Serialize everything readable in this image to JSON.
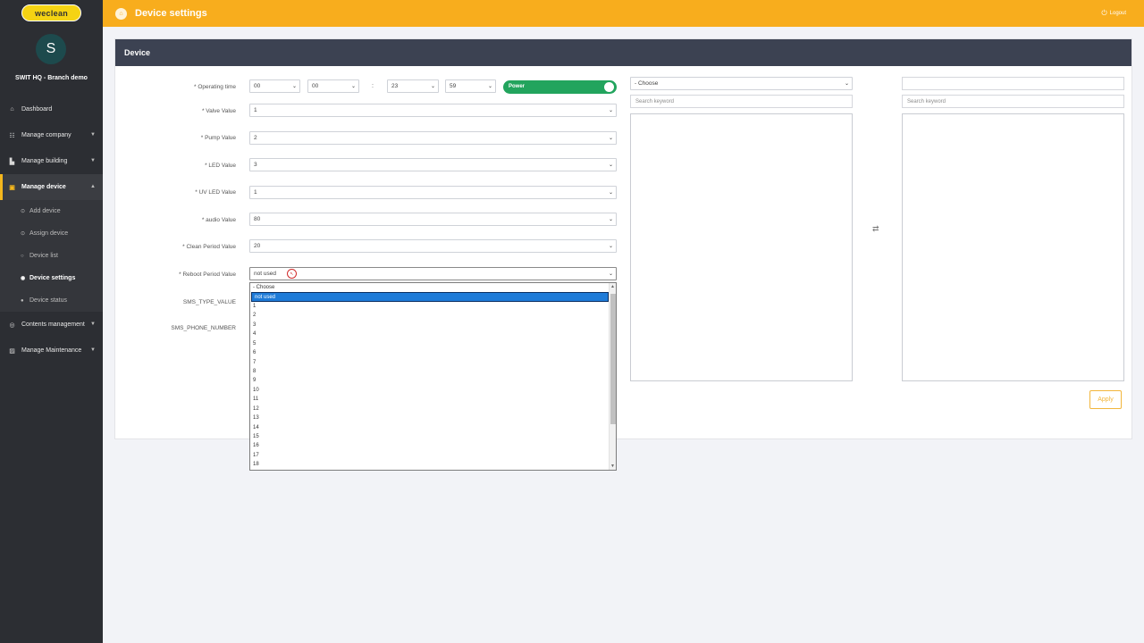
{
  "brand": {
    "logo_text": "weclean",
    "accent_color": "#f8ad1d"
  },
  "user": {
    "avatar_letter": "S",
    "branch": "SWIT HQ - Branch demo"
  },
  "sidebar": {
    "items": [
      {
        "label": "Dashboard",
        "icon": "home-icon"
      },
      {
        "label": "Manage company",
        "icon": "users-icon"
      },
      {
        "label": "Manage building",
        "icon": "building-icon"
      },
      {
        "label": "Manage device",
        "icon": "device-icon"
      },
      {
        "label": "Contents management",
        "icon": "eye-icon"
      },
      {
        "label": "Manage Maintenance",
        "icon": "image-icon"
      }
    ],
    "sub_items": [
      {
        "label": "Add device"
      },
      {
        "label": "Assign device"
      },
      {
        "label": "Device list"
      },
      {
        "label": "Device settings"
      },
      {
        "label": "Device status"
      }
    ]
  },
  "header": {
    "title": "Device settings",
    "logout_label": "Logout"
  },
  "card": {
    "title": "Device"
  },
  "form": {
    "operating_time_label": "* Operating time",
    "op_h1": "00",
    "op_m1": "00",
    "op_colon": ":",
    "op_h2": "23",
    "op_m2": "59",
    "power_label": "Power",
    "valve_label": "* Valve Value",
    "valve_value": "1",
    "pump_label": "* Pump Value",
    "pump_value": "2",
    "led_label": "* LED Value",
    "led_value": "3",
    "uvled_label": "* UV LED Value",
    "uvled_value": "1",
    "audio_label": "* audio Value",
    "audio_value": "80",
    "clean_label": "* Clean Period Value",
    "clean_value": "20",
    "reboot_label": "* Reboot Period Value",
    "reboot_value": "not used",
    "sms_type_label": "SMS_TYPE_VALUE",
    "sms_phone_label": "SMS_PHONE_NUMBER"
  },
  "right_panel": {
    "choose_value": "- Choose",
    "search_placeholder_left": "Search keyword",
    "search_placeholder_right": "Search keyword",
    "apply_label": "Apply"
  },
  "dropdown": {
    "options": [
      "- Choose",
      "not used",
      "1",
      "2",
      "3",
      "4",
      "5",
      "6",
      "7",
      "8",
      "9",
      "10",
      "11",
      "12",
      "13",
      "14",
      "15",
      "16",
      "17",
      "18"
    ],
    "highlighted_index": 1,
    "highlight_color": "#1e7bd8"
  }
}
